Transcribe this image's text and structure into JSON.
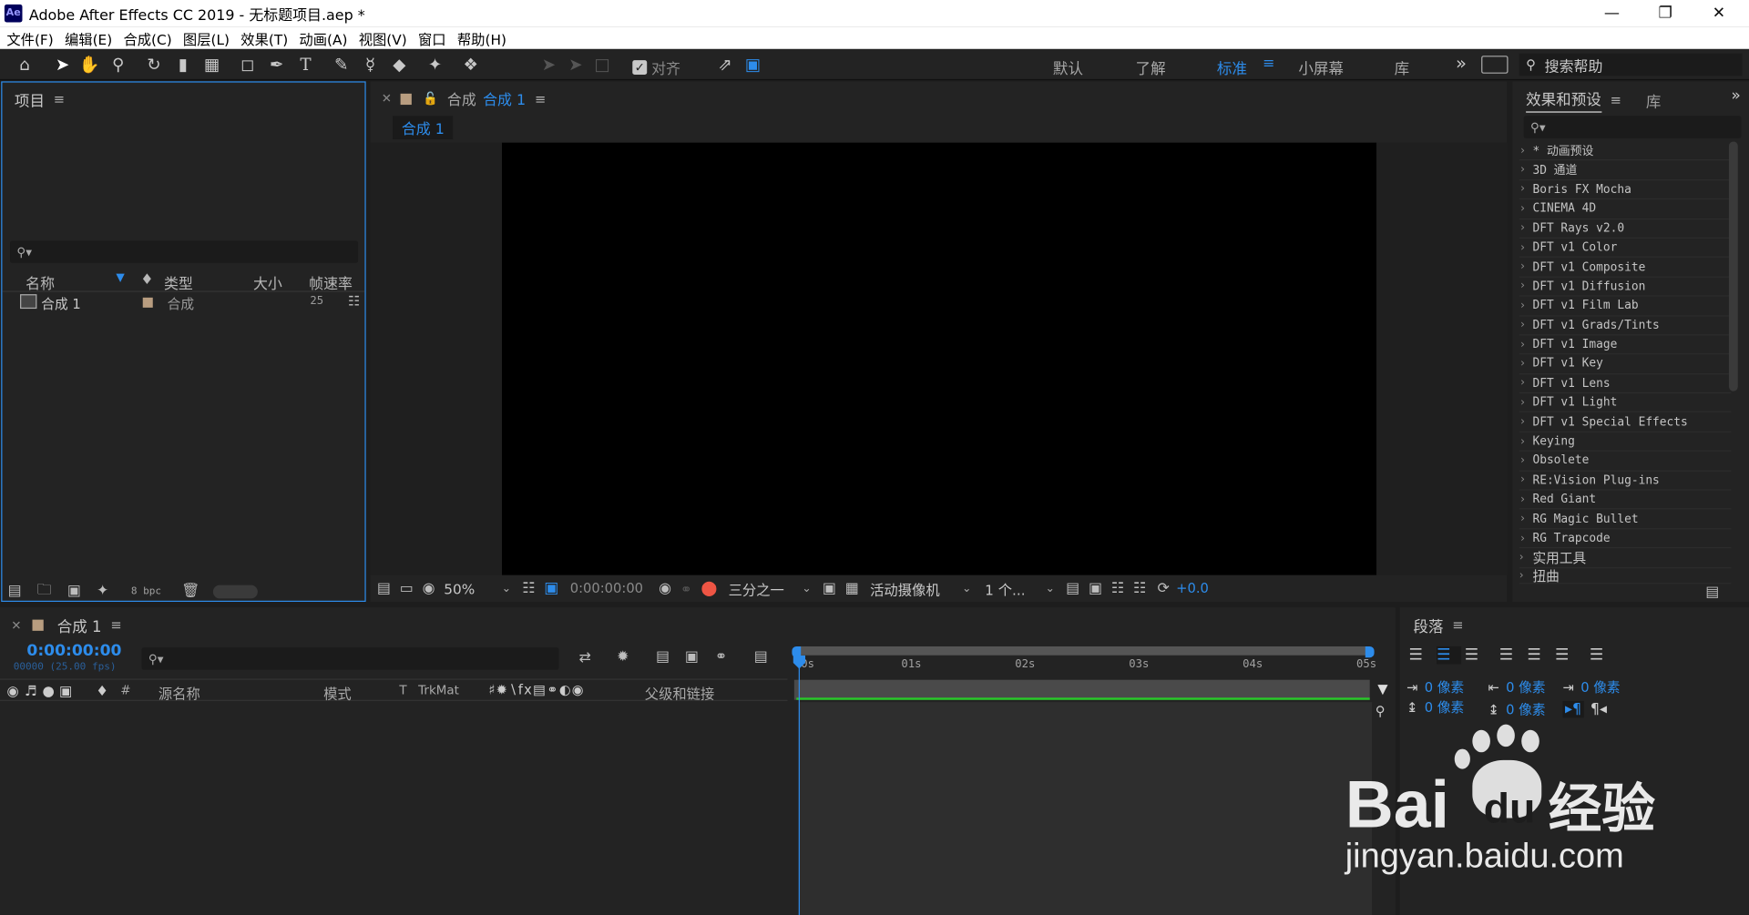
{
  "title_bar": {
    "app_icon": "Ae",
    "title": "Adobe After Effects CC 2019 - 无标题项目.aep *"
  },
  "menu": [
    "文件(F)",
    "编辑(E)",
    "合成(C)",
    "图层(L)",
    "效果(T)",
    "动画(A)",
    "视图(V)",
    "窗口",
    "帮助(H)"
  ],
  "toolbar": {
    "snap_label": "对齐",
    "snap_checked": true
  },
  "workspaces": {
    "items": [
      "默认",
      "了解",
      "标准",
      "小屏幕",
      "库"
    ],
    "active": "标准",
    "overflow": "»"
  },
  "search_help": {
    "placeholder": "搜索帮助"
  },
  "project_panel": {
    "title": "项目",
    "columns": [
      "名称",
      "类型",
      "大小",
      "帧速率"
    ],
    "items": [
      {
        "name": "合成 1",
        "type": "合成",
        "size": "",
        "fps": "25"
      }
    ],
    "bpc": "8 bpc"
  },
  "comp_panel": {
    "tab_prefix": "合成",
    "tab_name": "合成 1",
    "breadcrumb": "合成 1",
    "zoom": "50%",
    "timecode": "0:00:00:00",
    "resolution": "三分之一",
    "camera": "活动摄像机",
    "views": "1 个...",
    "exposure": "+0.0"
  },
  "effects_panel": {
    "tabs": [
      "效果和预设",
      "库"
    ],
    "items": [
      "* 动画预设",
      "3D 通道",
      "Boris FX Mocha",
      "CINEMA 4D",
      "DFT Rays v2.0",
      "DFT v1 Color",
      "DFT v1 Composite",
      "DFT v1 Diffusion",
      "DFT v1 Film Lab",
      "DFT v1 Grads/Tints",
      "DFT v1 Image",
      "DFT v1 Key",
      "DFT v1 Lens",
      "DFT v1 Light",
      "DFT v1 Special Effects",
      "Keying",
      "Obsolete",
      "RE:Vision Plug-ins",
      "Red Giant",
      "RG Magic Bullet",
      "RG Trapcode",
      "实用工具",
      "扭曲"
    ]
  },
  "timeline": {
    "tab": "合成 1",
    "timecode": "0:00:00:00",
    "frame_info": "00000 (25.00 fps)",
    "columns": {
      "hash": "#",
      "source": "源名称",
      "mode": "模式",
      "t": "T",
      "trkmat": "TrkMat",
      "parent": "父级和链接"
    },
    "ruler": [
      "0s",
      "01s",
      "02s",
      "03s",
      "04s",
      "05s"
    ]
  },
  "paragraph_panel": {
    "title": "段落",
    "indent_left": "0 像素",
    "indent_before": "0 像素",
    "indent_first": "0 像素",
    "space_before": "0 像素",
    "space_after": "0 像素"
  },
  "watermark": {
    "logo": "Bai du 经验",
    "url": "jingyan.baidu.com"
  },
  "colors": {
    "accent": "#2d8ceb",
    "panel": "#232323",
    "bg": "#1d1d1d",
    "green_bar": "#28c828"
  }
}
